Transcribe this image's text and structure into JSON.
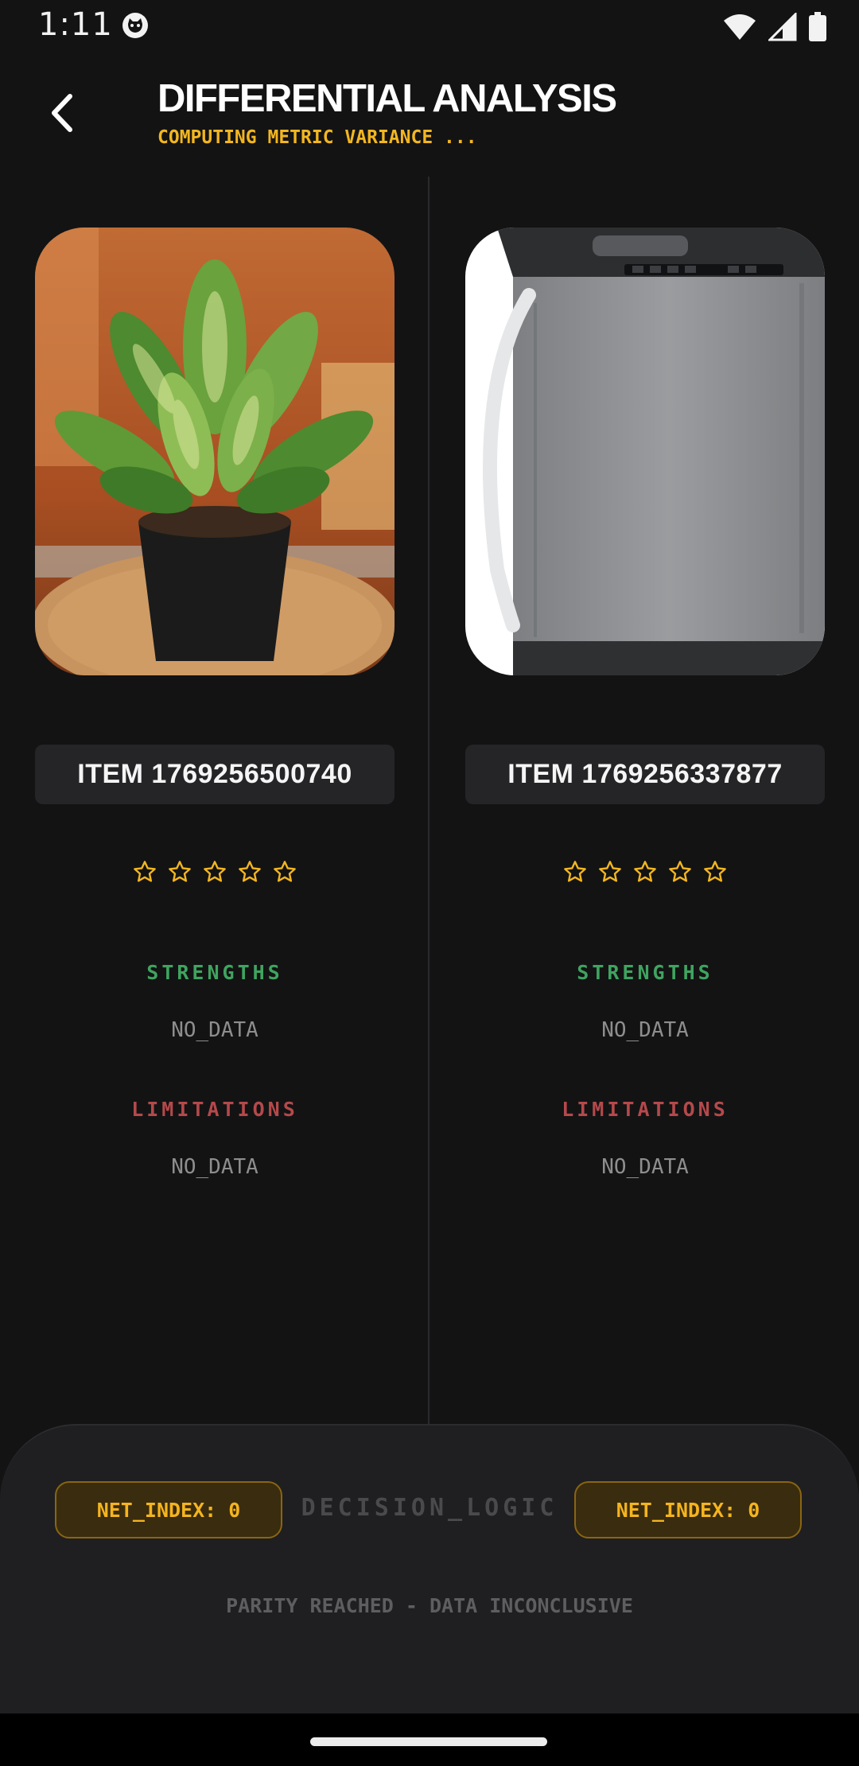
{
  "status_bar": {
    "time": "1:11"
  },
  "header": {
    "title": "DIFFERENTIAL ANALYSIS",
    "subtitle": "COMPUTING METRIC VARIANCE ..."
  },
  "items": [
    {
      "name": "ITEM 1769256500740",
      "image_icon": "potted-plant",
      "rating": 0,
      "max_rating": 5,
      "strengths_label": "STRENGTHS",
      "strengths_value": "NO_DATA",
      "limitations_label": "LIMITATIONS",
      "limitations_value": "NO_DATA"
    },
    {
      "name": "ITEM 1769256337877",
      "image_icon": "washing-machine",
      "rating": 0,
      "max_rating": 5,
      "strengths_label": "STRENGTHS",
      "strengths_value": "NO_DATA",
      "limitations_label": "LIMITATIONS",
      "limitations_value": "NO_DATA"
    }
  ],
  "decision": {
    "left_index": "NET_INDEX: 0",
    "center_label": "DECISION_LOGIC",
    "right_index": "NET_INDEX: 0",
    "result": "PARITY REACHED - DATA INCONCLUSIVE"
  },
  "colors": {
    "accent": "#f2b620",
    "strengths": "#3fa45f",
    "limitations": "#b4494b",
    "background": "#131314"
  }
}
